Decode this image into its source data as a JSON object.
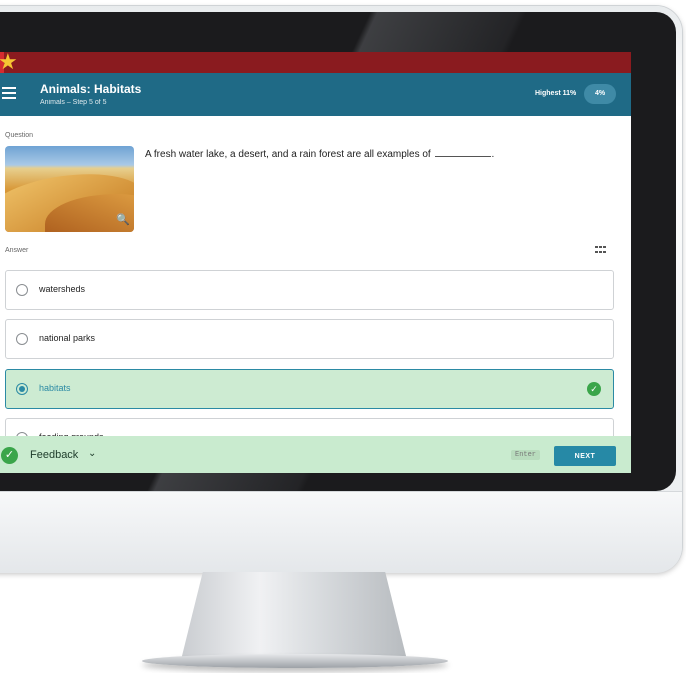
{
  "progress": {
    "percent_label": "4%",
    "fraction": 0.04
  },
  "header": {
    "title": "Animals: Habitats",
    "subtitle": "Animals – Step 5 of 5",
    "highest_label": "Highest 11%",
    "score_badge": "4%"
  },
  "question": {
    "label": "Question",
    "text": "A fresh water lake, a desert, and a rain forest are all examples of",
    "end_punct": "."
  },
  "answer": {
    "label": "Answer",
    "options": [
      {
        "label": "watersheds",
        "selected": false
      },
      {
        "label": "national parks",
        "selected": false
      },
      {
        "label": "habitats",
        "selected": true
      },
      {
        "label": "feeding grounds",
        "selected": false
      }
    ]
  },
  "footer": {
    "feedback_label": "Feedback",
    "enter_hint": "Enter",
    "next_label": "NEXT"
  },
  "colors": {
    "header_bg": "#1f6a86",
    "accent": "#2689a6",
    "correct_green": "#3aa54a",
    "progress_red": "#8a1b1f"
  },
  "icons": [
    "menu-icon",
    "star-icon",
    "zoom-icon",
    "grid-icon",
    "check-icon",
    "chevron-down-icon"
  ]
}
